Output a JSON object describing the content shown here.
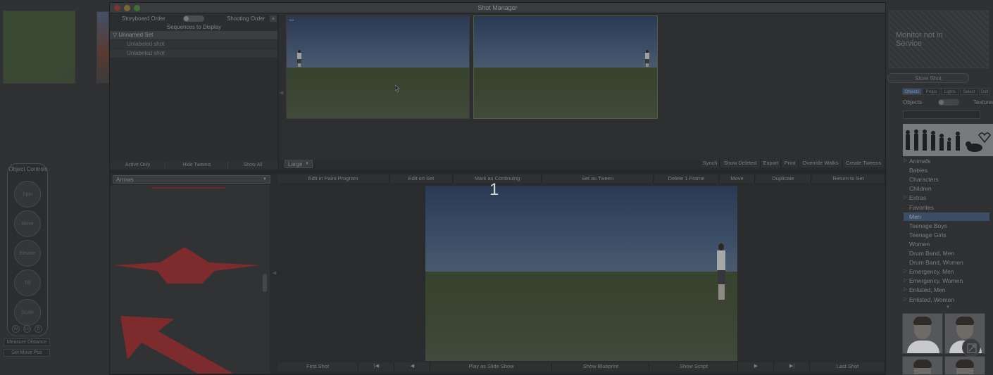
{
  "window": {
    "title": "Shot Manager"
  },
  "left_panel": {
    "storyboard_order_label": "Storyboard Order",
    "shooting_order_label": "Shooting Order",
    "sequences_label": "Sequences to Display",
    "set_name": "Unnamed Set",
    "shots": [
      "Unlabeled shot",
      "Unlabeled shot"
    ],
    "filter_buttons": [
      "Active Only",
      "Hide Tweens",
      "Show All"
    ],
    "arrows_select": "Arrows"
  },
  "thumb_toolbar": {
    "size_select": "Large",
    "buttons": [
      "Synch",
      "Show Deleted",
      "Export",
      "Print",
      "Override Walks",
      "Create Tweens"
    ]
  },
  "edit_toolbar": [
    "Edit in Paint Program",
    "Edit on Set",
    "Mark as Continuing",
    "Set as Tween",
    "Delete 1 Frame",
    "Move",
    "Duplicate",
    "Return to Set"
  ],
  "frame_number": "1",
  "bottom_toolbar": {
    "first_shot": "First Shot",
    "play": "Play as Slide Show",
    "show_blueprint": "Show Blueprint",
    "show_script": "Show Script",
    "last_shot": "Last Shot",
    "first_glyph": "|◀",
    "prev_glyph": "◀",
    "next_glyph": "▶",
    "last_glyph": "▶|"
  },
  "object_controls": {
    "title": "Object Controls",
    "buttons": [
      "Spin",
      "Move",
      "Elevate",
      "Tilt",
      "Scale"
    ],
    "mini": [
      "W",
      "Lo",
      "D"
    ],
    "measure_distance": "Measure Distance",
    "bottom_button": "Set Move Pos"
  },
  "right_panel": {
    "monitor_text": "Monitor not in Service",
    "store_shot": "Store Shot",
    "tabs": [
      "Objects",
      "Props",
      "Lights",
      "Select",
      "Dolf"
    ],
    "objects_label": "Objects",
    "textures_label": "Textures",
    "categories": [
      {
        "label": "Animals",
        "expandable": true,
        "selected": false
      },
      {
        "label": "Babies",
        "expandable": false,
        "selected": false
      },
      {
        "label": "Characters",
        "expandable": false,
        "selected": false
      },
      {
        "label": "Children",
        "expandable": false,
        "selected": false
      },
      {
        "label": "Extras",
        "expandable": true,
        "selected": false
      },
      {
        "label": "Favorites",
        "expandable": false,
        "selected": false
      },
      {
        "label": "Men",
        "expandable": false,
        "selected": true
      },
      {
        "label": "Teenage Boys",
        "expandable": false,
        "selected": false
      },
      {
        "label": "Teenage Girls",
        "expandable": false,
        "selected": false
      },
      {
        "label": "Women",
        "expandable": false,
        "selected": false
      },
      {
        "label": "Drum Band, Men",
        "expandable": false,
        "selected": false
      },
      {
        "label": "Drum Band, Women",
        "expandable": false,
        "selected": false
      },
      {
        "label": "Emergency, Men",
        "expandable": true,
        "selected": false
      },
      {
        "label": "Emergency, Women",
        "expandable": true,
        "selected": false
      },
      {
        "label": "Enlisted, Men",
        "expandable": true,
        "selected": false
      },
      {
        "label": "Enlisted, Women",
        "expandable": true,
        "selected": false
      }
    ]
  },
  "colors": {
    "arrow_red": "#7d2b2d",
    "selection_blue": "#3d4d66"
  }
}
